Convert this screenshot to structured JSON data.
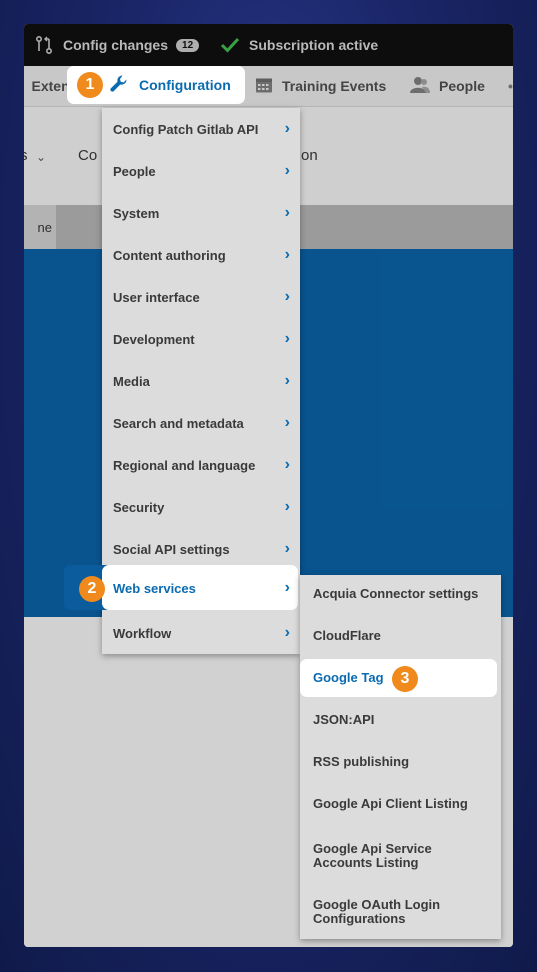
{
  "topbar": {
    "config_changes_label": "Config changes",
    "config_changes_count": "12",
    "subscription_label": "Subscription active"
  },
  "navbar": {
    "extend_label": "Extend",
    "configuration_label": "Configuration",
    "training_events_label": "Training Events",
    "people_label": "People"
  },
  "page": {
    "header_left": "s",
    "header_left2": "Co",
    "header_right": "on",
    "tab_label": "ne"
  },
  "menu": {
    "items": [
      {
        "label": "Config Patch Gitlab API"
      },
      {
        "label": "People"
      },
      {
        "label": "System"
      },
      {
        "label": "Content authoring"
      },
      {
        "label": "User interface"
      },
      {
        "label": "Development"
      },
      {
        "label": "Media"
      },
      {
        "label": "Search and metadata"
      },
      {
        "label": "Regional and language"
      },
      {
        "label": "Security"
      },
      {
        "label": "Social API settings"
      },
      {
        "label": "Web services"
      },
      {
        "label": "Workflow"
      }
    ]
  },
  "submenu": {
    "items": [
      {
        "label": "Acquia Connector settings"
      },
      {
        "label": "CloudFlare"
      },
      {
        "label": "Google Tag"
      },
      {
        "label": "JSON:API"
      },
      {
        "label": "RSS publishing"
      },
      {
        "label": "Google Api Client Listing"
      },
      {
        "label": "Google Api Service Accounts Listing"
      },
      {
        "label": "Google OAuth Login Configurations"
      }
    ]
  },
  "steps": {
    "one": "1",
    "two": "2",
    "three": "3"
  },
  "colors": {
    "accent_blue": "#0b6bb0",
    "step_orange": "#f08a1c",
    "check_green": "#3fae4a"
  }
}
